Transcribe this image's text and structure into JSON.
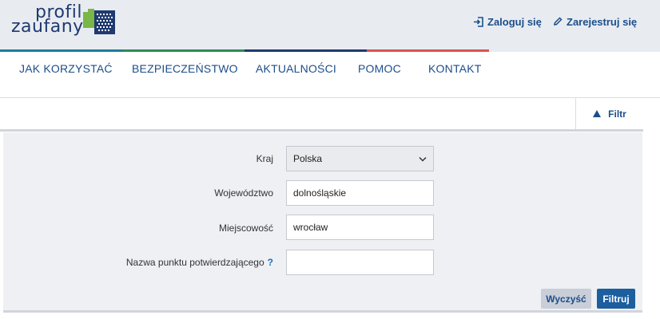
{
  "header": {
    "logo_line1": "profil",
    "logo_line2": "zaufany",
    "login_label": "Zaloguj się",
    "register_label": "Zarejestruj się"
  },
  "colors": {
    "brand": "#1c4e8a",
    "bar": [
      "#1c7d9c",
      "#2e8b57",
      "#1f3a6e",
      "#d9534f"
    ]
  },
  "nav": {
    "items": [
      {
        "label": "JAK KORZYSTAĆ"
      },
      {
        "label": "BEZPIECZEŃSTWO"
      },
      {
        "label": "AKTUALNOŚCI"
      },
      {
        "label": "POMOC"
      },
      {
        "label": "KONTAKT"
      }
    ]
  },
  "filter": {
    "toggle_label": "Filtr",
    "fields": {
      "country": {
        "label": "Kraj",
        "value": "Polska"
      },
      "voivodeship": {
        "label": "Województwo",
        "value": "dolnośląskie"
      },
      "city": {
        "label": "Miejscowość",
        "value": "wrocław"
      },
      "point": {
        "label": "Nazwa punktu potwierdzającego",
        "help": "?",
        "value": ""
      }
    },
    "clear_label": "Wyczyść",
    "submit_label": "Filtruj"
  }
}
